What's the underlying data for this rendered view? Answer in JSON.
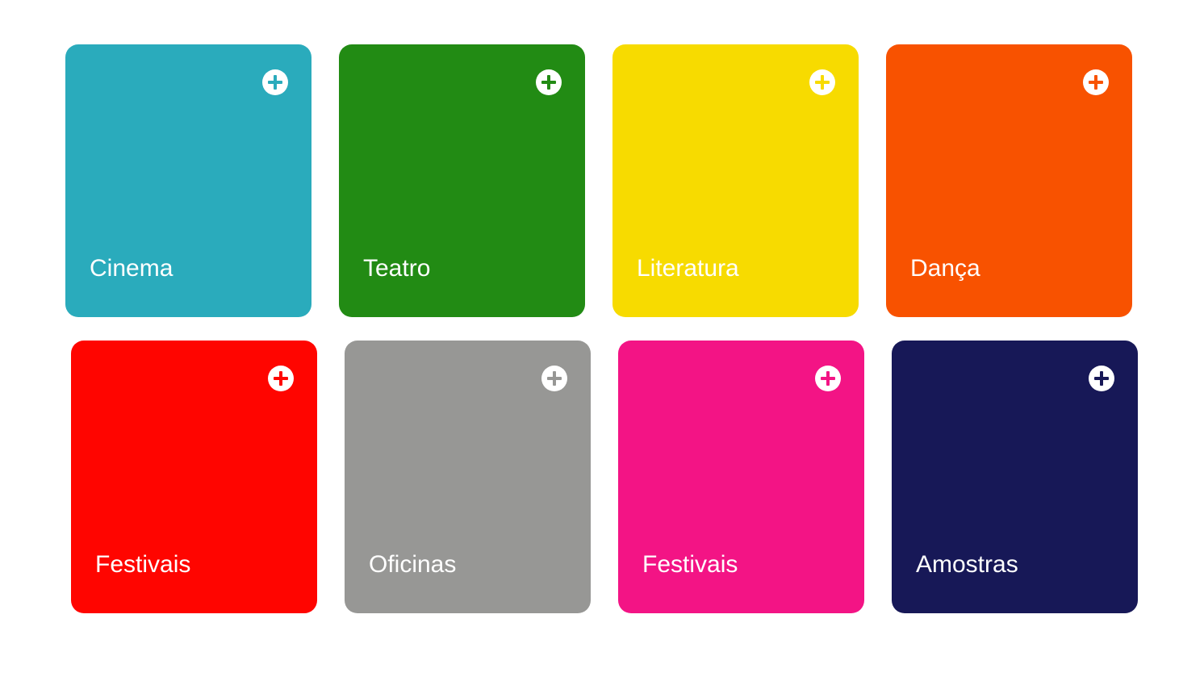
{
  "tiles": [
    {
      "label": "Cinema",
      "color": "#2AABBC",
      "icon": "plus-circle-icon"
    },
    {
      "label": "Teatro",
      "color": "#228B14",
      "icon": "plus-circle-icon"
    },
    {
      "label": "Literatura",
      "color": "#F7DB00",
      "icon": "plus-circle-icon"
    },
    {
      "label": "Dança",
      "color": "#F85200",
      "icon": "plus-circle-icon"
    },
    {
      "label": "Festivais",
      "color": "#FF0500",
      "icon": "plus-circle-icon"
    },
    {
      "label": "Oficinas",
      "color": "#979795",
      "icon": "plus-circle-icon"
    },
    {
      "label": "Festivais",
      "color": "#F31485",
      "icon": "plus-circle-icon"
    },
    {
      "label": "Amostras",
      "color": "#171857",
      "icon": "plus-circle-icon"
    }
  ]
}
